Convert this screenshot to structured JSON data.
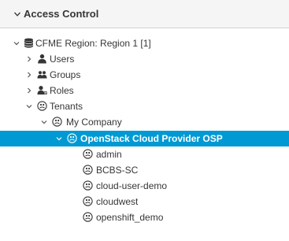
{
  "accordion": {
    "title": "Access Control",
    "expanded": true
  },
  "tree": {
    "root": "CFME Region: Region 1 [1]",
    "users": "Users",
    "groups": "Groups",
    "roles": "Roles",
    "tenants": "Tenants",
    "my_company": "My Company",
    "osp": "OpenStack Cloud Provider OSP",
    "children": [
      "admin",
      "BCBS-SC",
      "cloud-user-demo",
      "cloudwest",
      "openshift_demo"
    ]
  },
  "colors": {
    "selection": "#0099d3",
    "header_bg": "#f5f5f5",
    "text": "#363636"
  },
  "icons": {
    "root": "database-icon",
    "users": "user-icon",
    "groups": "group-icon",
    "roles": "role-icon",
    "tenant": "tenant-icon"
  }
}
